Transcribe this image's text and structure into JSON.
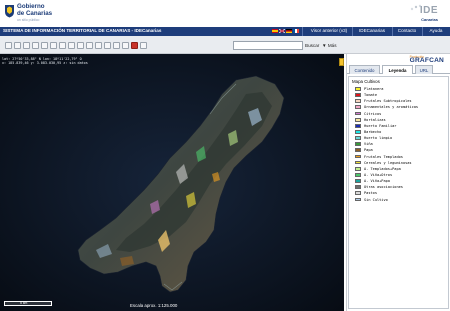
{
  "header": {
    "gov_name_line1": "Gobierno",
    "gov_name_line2": "de Canarias",
    "gov_tagline": "un sitio público",
    "ide_logo_text": "IDE",
    "ide_logo_sub": "Canarias"
  },
  "navbar": {
    "title": "SISTEMA DE INFORMACIÓN TERRITORIAL DE CANARIAS - IDECanarias",
    "links": [
      "Visor anterior (v3)",
      "IDECanarias",
      "Contacto",
      "Ayuda"
    ],
    "colors": {
      "bar": "#1e3d7b"
    }
  },
  "toolbar": {
    "search_placeholder": "",
    "search_button": "Buscar",
    "prev_view": "▼ Más"
  },
  "map": {
    "coord_line1": "lat: 27º50'33,88\" N lon: 18º11'22,79\" O",
    "coord_line2": "x: 185.839,46  y: 3.083.030,95  z: sin datos",
    "scalebar_label": "5 km",
    "scale_text": "Escala aprox. 1:125.000"
  },
  "panel": {
    "grafcan_small": "Producido",
    "grafcan_big": "GRAFCAN",
    "tabs": [
      "Contenido",
      "Leyenda",
      "URL"
    ],
    "active_tab": "Leyenda",
    "legend_title": "Mapa Cultivos",
    "legend": [
      {
        "label": "Platanera",
        "color": "#f7f22f"
      },
      {
        "label": "Tomate",
        "color": "#e0141a"
      },
      {
        "label": "Frutales Subtropicales",
        "color": "#f6d6c1"
      },
      {
        "label": "Ornamentales y aromáticas",
        "color": "#f2a7c7"
      },
      {
        "label": "Cítricos",
        "color": "#d17ad0"
      },
      {
        "label": "Hortalizas",
        "color": "#f8e6a0"
      },
      {
        "label": "Huerto Familiar",
        "color": "#1a2bb5"
      },
      {
        "label": "Barbecho",
        "color": "#1ee7e7"
      },
      {
        "label": "Huerto limpio",
        "color": "#69d8d8"
      },
      {
        "label": "Viña",
        "color": "#3a9a3c"
      },
      {
        "label": "Papa",
        "color": "#8a5e28"
      },
      {
        "label": "Frutales Templados",
        "color": "#f1a01e"
      },
      {
        "label": "Cereales y leguminosas",
        "color": "#f3e03c"
      },
      {
        "label": "A. Templados+Papa",
        "color": "#c2f08e"
      },
      {
        "label": "A. Viña+Otros",
        "color": "#4cc86c"
      },
      {
        "label": "A. Viña+Papa",
        "color": "#1ca5a0"
      },
      {
        "label": "Otras asociaciones",
        "color": "#6e6e6e"
      },
      {
        "label": "Pastos",
        "color": "#d9d9d9"
      },
      {
        "label": "Sin Cultivo",
        "color": "#aecbe8"
      }
    ]
  }
}
